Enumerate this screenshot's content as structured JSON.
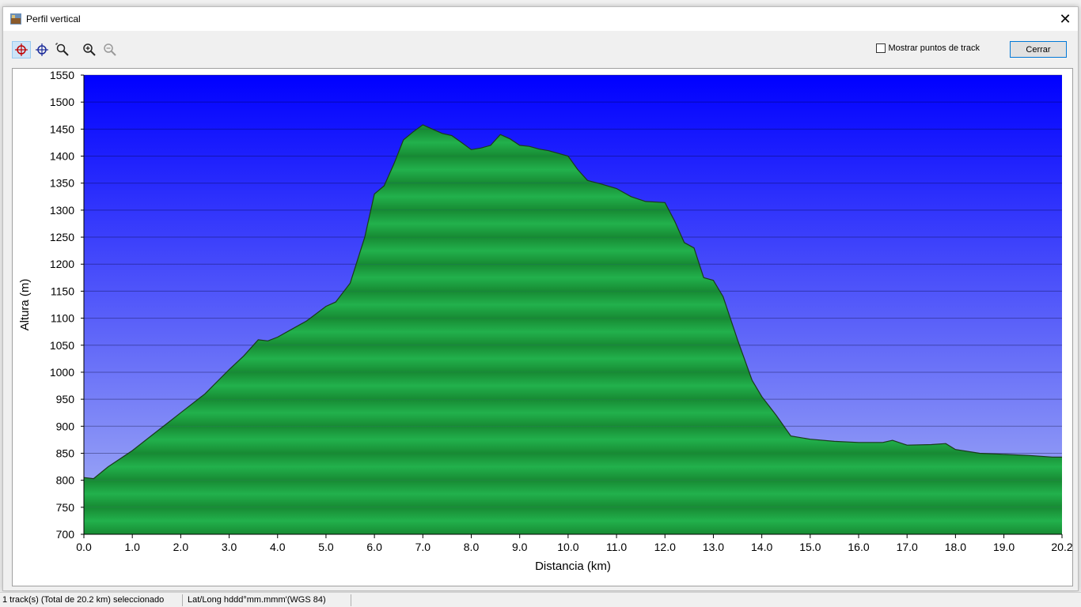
{
  "window": {
    "title": "Perfil vertical",
    "close_symbol": "✕"
  },
  "toolbar": {
    "tools": [
      {
        "name": "select-crosshair-icon",
        "active": true
      },
      {
        "name": "crosshair-icon",
        "active": false
      },
      {
        "name": "zoom-area-icon",
        "active": false
      },
      {
        "name": "zoom-in-icon",
        "active": false
      },
      {
        "name": "zoom-out-icon",
        "active": false
      }
    ],
    "show_track_points_label": "Mostrar puntos de track",
    "show_track_points_checked": false,
    "close_button_label": "Cerrar"
  },
  "chart_data": {
    "type": "area",
    "xlabel": "Distancia (km)",
    "ylabel": "Altura (m)",
    "xlim": [
      0,
      20.2
    ],
    "ylim": [
      700,
      1550
    ],
    "xticks": [
      "0.0",
      "1.0",
      "2.0",
      "3.0",
      "4.0",
      "5.0",
      "6.0",
      "7.0",
      "8.0",
      "9.0",
      "10.0",
      "11.0",
      "12.0",
      "13.0",
      "14.0",
      "15.0",
      "16.0",
      "17.0",
      "18.0",
      "19.0",
      "20.2"
    ],
    "yticks": [
      "1550",
      "1500",
      "1450",
      "1400",
      "1350",
      "1300",
      "1250",
      "1200",
      "1150",
      "1100",
      "1050",
      "1000",
      "950",
      "900",
      "850",
      "800",
      "750",
      "700"
    ],
    "colors": {
      "sky_top": "#0000ff",
      "sky_bottom": "#a8b4f4",
      "fill_light": "#22b14c",
      "fill_dark": "#178a33",
      "line": "#1a3a1a"
    },
    "series": [
      {
        "x": [
          0,
          0.2,
          0.5,
          1,
          1.5,
          2,
          2.5,
          3,
          3.3,
          3.6,
          3.8,
          4.0,
          4.3,
          4.6,
          5.0,
          5.2,
          5.5,
          5.8,
          6.0,
          6.2,
          6.4,
          6.6,
          6.8,
          7.0,
          7.2,
          7.4,
          7.6,
          7.8,
          8.0,
          8.2,
          8.4,
          8.6,
          8.8,
          9.0,
          9.2,
          9.4,
          9.6,
          9.8,
          10.0,
          10.2,
          10.4,
          10.7,
          11.0,
          11.3,
          11.6,
          12.0,
          12.2,
          12.4,
          12.6,
          12.8,
          13.0,
          13.2,
          13.5,
          13.8,
          14.0,
          14.3,
          14.6,
          15.0,
          15.5,
          16.0,
          16.5,
          16.7,
          17.0,
          17.5,
          17.8,
          18.0,
          18.5,
          19.0,
          19.5,
          20.0,
          20.2
        ],
        "y": [
          805,
          803,
          825,
          855,
          890,
          925,
          960,
          1005,
          1030,
          1060,
          1058,
          1065,
          1080,
          1095,
          1122,
          1130,
          1165,
          1250,
          1330,
          1345,
          1385,
          1430,
          1445,
          1458,
          1450,
          1442,
          1438,
          1425,
          1412,
          1415,
          1420,
          1440,
          1432,
          1420,
          1418,
          1413,
          1410,
          1405,
          1400,
          1375,
          1355,
          1348,
          1340,
          1325,
          1316,
          1314,
          1280,
          1240,
          1230,
          1175,
          1170,
          1140,
          1060,
          985,
          955,
          920,
          882,
          876,
          872,
          870,
          870,
          874,
          865,
          866,
          868,
          857,
          850,
          848,
          846,
          843,
          843
        ]
      }
    ]
  },
  "statusbar": {
    "selection": "1 track(s) (Total de 20.2 km) seleccionado",
    "coord_format": "Lat/Long hddd°mm.mmm'(WGS 84)"
  }
}
